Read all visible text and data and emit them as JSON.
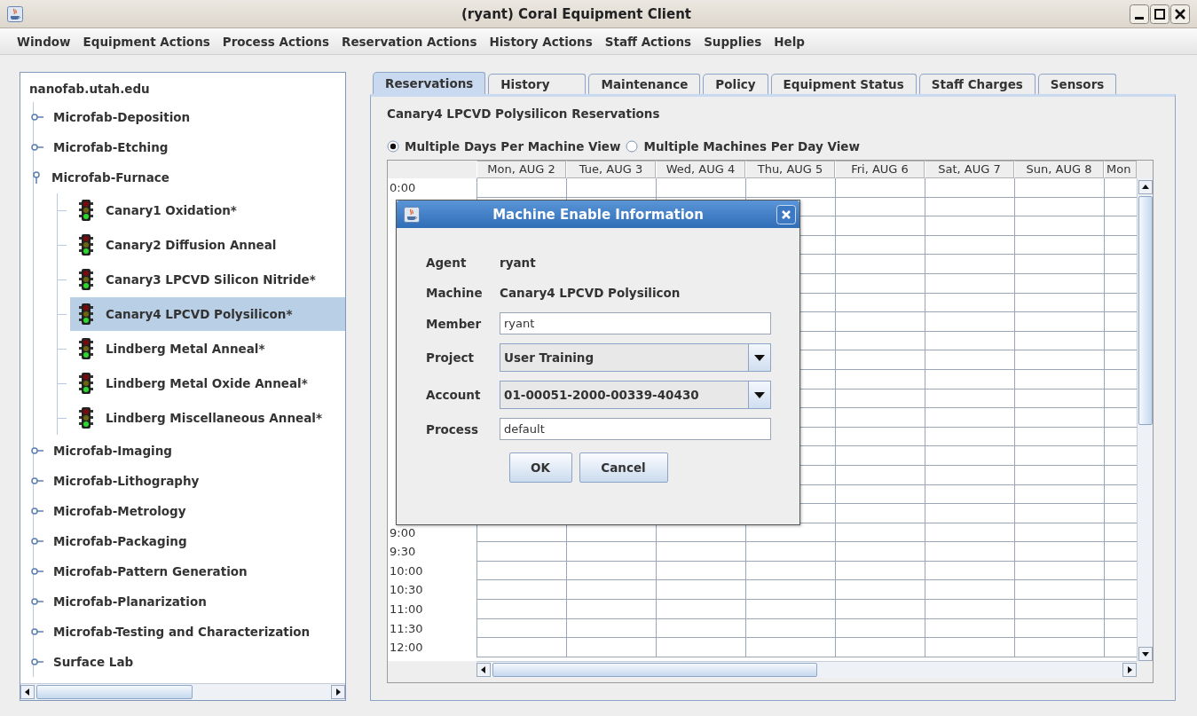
{
  "window": {
    "title": "(ryant) Coral Equipment Client"
  },
  "menu": [
    "Window",
    "Equipment Actions",
    "Process Actions",
    "Reservation Actions",
    "History Actions",
    "Staff Actions",
    "Supplies",
    "Help"
  ],
  "tree": {
    "label": "nanofab.utah.edu",
    "selected": false,
    "children": [
      {
        "label": "Microfab-Deposition",
        "expanded": false,
        "selected": false
      },
      {
        "label": "Microfab-Etching",
        "expanded": false,
        "selected": false
      },
      {
        "label": "Microfab-Furnace",
        "expanded": true,
        "selected": false,
        "children": [
          {
            "label": "Canary1 Oxidation*",
            "selected": false
          },
          {
            "label": "Canary2 Diffusion Anneal",
            "selected": false
          },
          {
            "label": "Canary3 LPCVD Silicon Nitride*",
            "selected": false
          },
          {
            "label": "Canary4 LPCVD Polysilicon*",
            "selected": true
          },
          {
            "label": "Lindberg Metal Anneal*",
            "selected": false
          },
          {
            "label": "Lindberg Metal Oxide Anneal*",
            "selected": false
          },
          {
            "label": "Lindberg Miscellaneous Anneal*",
            "selected": false
          }
        ]
      },
      {
        "label": "Microfab-Imaging",
        "expanded": false,
        "selected": false
      },
      {
        "label": "Microfab-Lithography",
        "expanded": false,
        "selected": false
      },
      {
        "label": "Microfab-Metrology",
        "expanded": false,
        "selected": false
      },
      {
        "label": "Microfab-Packaging",
        "expanded": false,
        "selected": false
      },
      {
        "label": "Microfab-Pattern Generation",
        "expanded": false,
        "selected": false
      },
      {
        "label": "Microfab-Planarization",
        "expanded": false,
        "selected": false
      },
      {
        "label": "Microfab-Testing and Characterization",
        "expanded": false,
        "selected": false
      },
      {
        "label": "Surface Lab",
        "expanded": false,
        "selected": false
      }
    ]
  },
  "tabs": [
    {
      "label": "Reservations",
      "selected": true
    },
    {
      "label": "History",
      "selected": false
    },
    {
      "label": "Maintenance",
      "selected": false
    },
    {
      "label": "Policy",
      "selected": false
    },
    {
      "label": "Equipment Status",
      "selected": false
    },
    {
      "label": "Staff Charges",
      "selected": false
    },
    {
      "label": "Sensors",
      "selected": false
    }
  ],
  "reservations": {
    "heading": "Canary4 LPCVD Polysilicon Reservations",
    "view_options": [
      {
        "label": "Multiple Days Per Machine View",
        "selected": true
      },
      {
        "label": "Multiple Machines Per Day View",
        "selected": false
      }
    ],
    "columns": [
      "Mon, AUG 2",
      "Tue, AUG 3",
      "Wed, AUG 4",
      "Thu, AUG 5",
      "Fri, AUG 6",
      "Sat, AUG 7",
      "Sun, AUG 8",
      "Mon"
    ],
    "time_labels": [
      "0:00",
      "9:00",
      "9:30",
      "10:00",
      "10:30",
      "11:00",
      "11:30",
      "12:00"
    ]
  },
  "dialog": {
    "title": "Machine Enable Information",
    "fields": [
      {
        "kind": "text",
        "label": "Agent",
        "value": "ryant"
      },
      {
        "kind": "text",
        "label": "Machine",
        "value": "Canary4 LPCVD Polysilicon"
      },
      {
        "kind": "input",
        "label": "Member",
        "value": "ryant"
      },
      {
        "kind": "combo",
        "label": "Project",
        "value": "User Training"
      },
      {
        "kind": "combo",
        "label": "Account",
        "value": "01-00051-2000-00339-40430"
      },
      {
        "kind": "input",
        "label": "Process",
        "value": "default"
      }
    ],
    "buttons": [
      "OK",
      "Cancel"
    ]
  }
}
